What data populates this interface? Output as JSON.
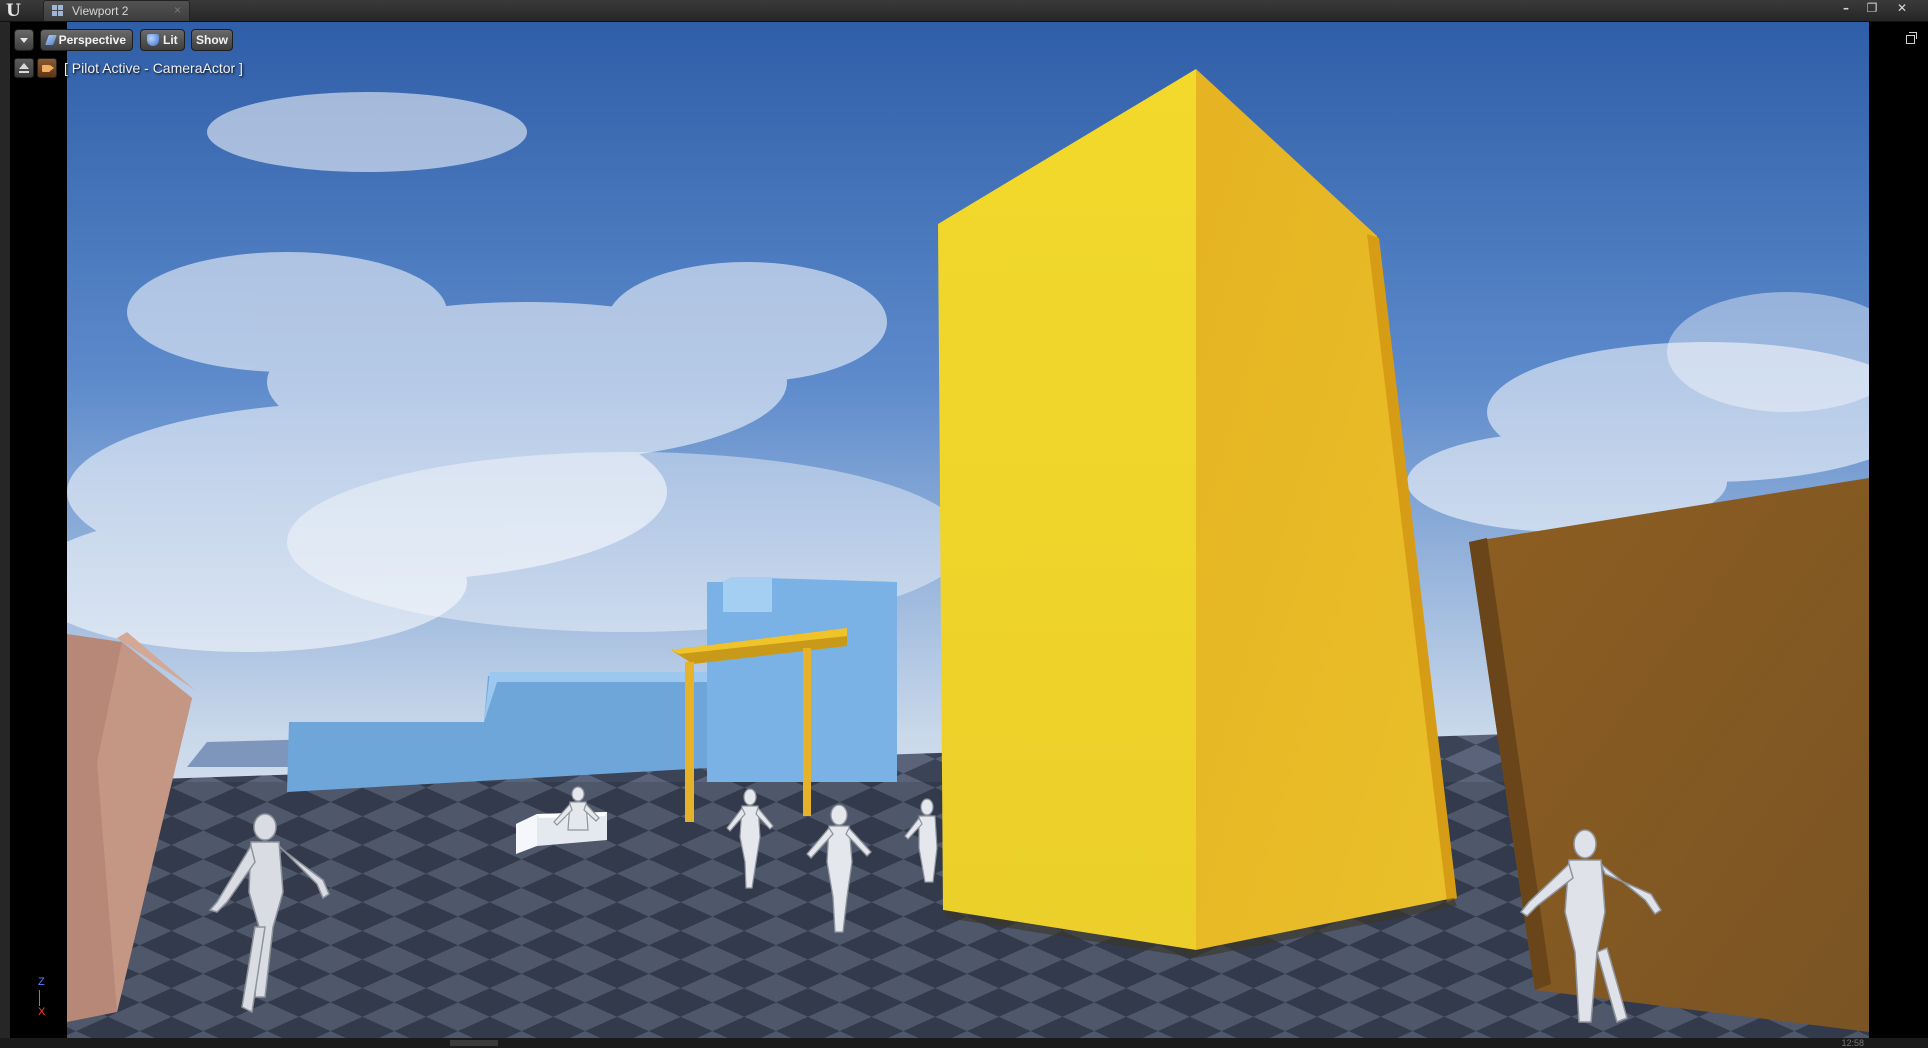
{
  "window": {
    "tab_label": "Viewport 2",
    "tab_close": "×",
    "controls": {
      "minimize": "–",
      "restore": "❐",
      "close": "✕"
    }
  },
  "viewport_toolbar": {
    "perspective_label": "Perspective",
    "lit_label": "Lit",
    "show_label": "Show",
    "pilot_status": "[ Pilot Active - CameraActor ]"
  },
  "axis_gizmo": {
    "z": "Z",
    "x": "X"
  },
  "status": {
    "time": "12:58"
  },
  "icons": {
    "logo": "unreal-logo-icon",
    "tab": "viewport-grid-icon",
    "dropdown": "chevron-down-icon",
    "perspective": "perspective-camera-icon",
    "lit": "lit-sphere-icon",
    "eject": "eject-icon",
    "pilot_camera": "camera-icon",
    "maximize": "maximize-icon"
  },
  "colors": {
    "sky": "#3c68b0",
    "tower_front": "#f0d62c",
    "tower_side": "#e2ae22",
    "brown_wall": "#8a5e24",
    "pink_block": "#b98b79",
    "blue_walls": "#7fb4e6",
    "floor_dark": "#3d4558",
    "floor_light": "#59627a"
  }
}
